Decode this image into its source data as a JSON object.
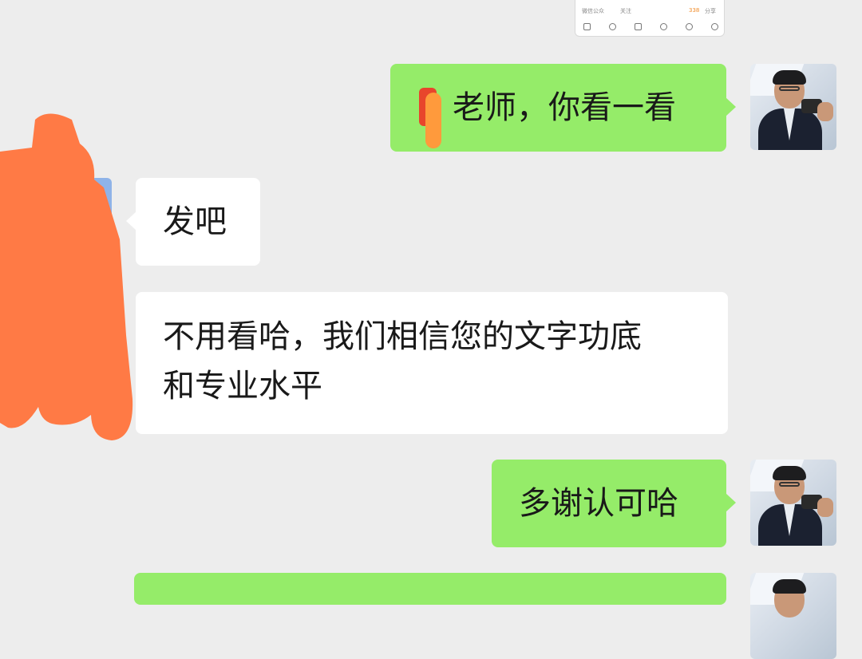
{
  "colors": {
    "background": "#ededed",
    "outgoing_bubble": "#95ec69",
    "incoming_bubble": "#ffffff",
    "redaction": "#ff7a45"
  },
  "shared_card": {
    "left_text": "微信公众",
    "mid_text": "关注",
    "count_text": "338",
    "right_text": "分享"
  },
  "messages": [
    {
      "direction": "out",
      "text": "老师，你看一看"
    },
    {
      "direction": "in",
      "text": "发吧"
    },
    {
      "direction": "in",
      "text": "不用看哈，我们相信您的文字功底\n和专业水平"
    },
    {
      "direction": "out",
      "text": "多谢认可哈"
    },
    {
      "direction": "out",
      "text": ""
    }
  ],
  "icons": {
    "avatar": "profile-photo-avatar",
    "card_icons": [
      "image-icon",
      "at-icon",
      "sliders-icon",
      "emoji-icon",
      "smile-icon",
      "add-icon"
    ]
  }
}
